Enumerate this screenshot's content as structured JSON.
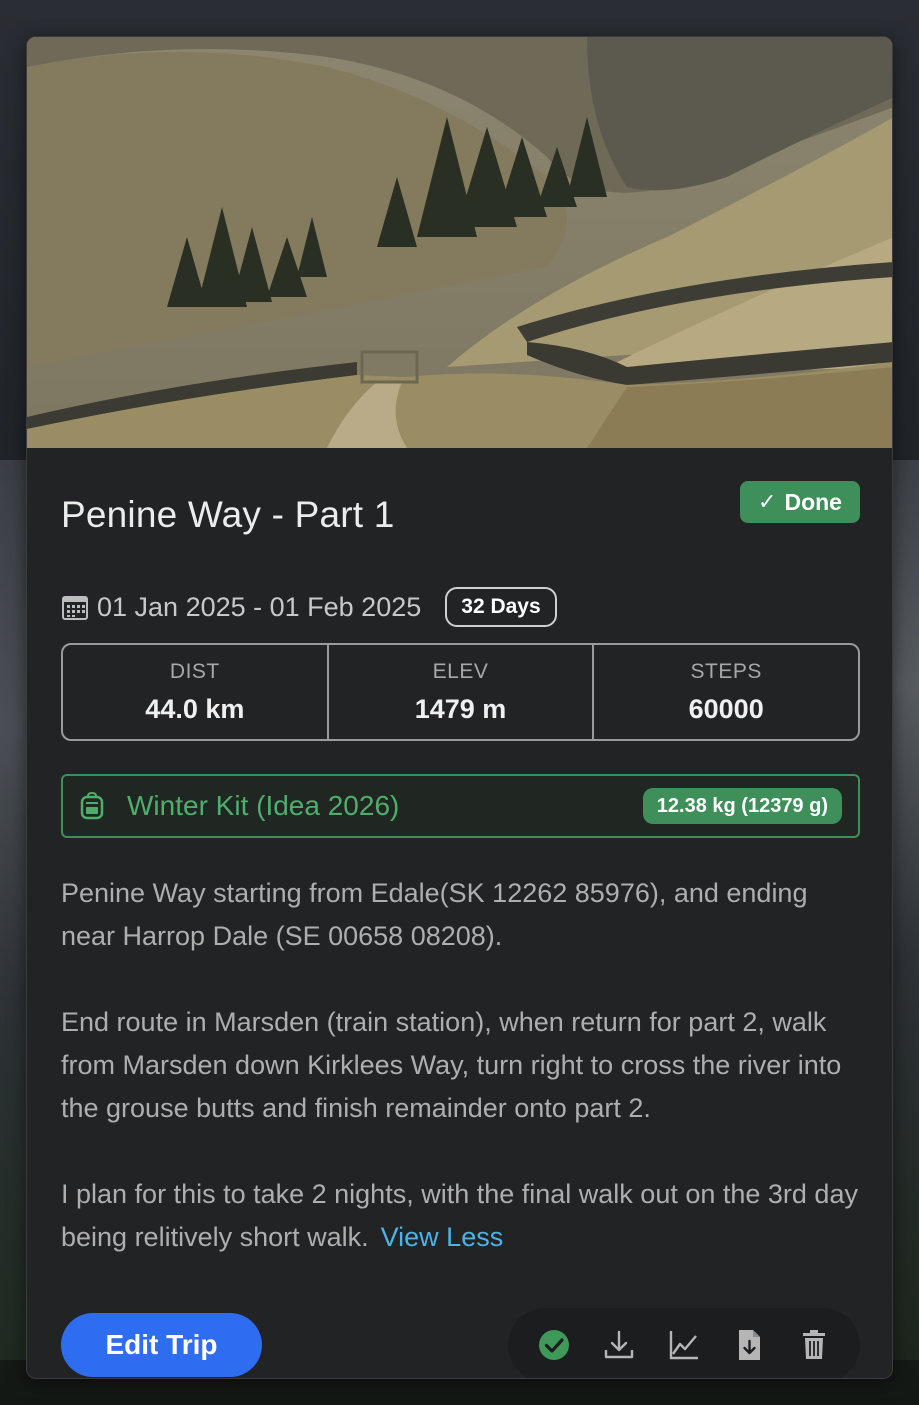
{
  "trip": {
    "title": "Penine Way - Part 1",
    "status": {
      "icon": "checkmark-icon",
      "label": "Done",
      "color": "#3f8f5a"
    },
    "date_range": "01 Jan 2025 - 01 Feb 2025",
    "duration": "32 Days"
  },
  "stats": [
    {
      "label": "DIST",
      "value": "44.0 km"
    },
    {
      "label": "ELEV",
      "value": "1479 m"
    },
    {
      "label": "STEPS",
      "value": "60000"
    }
  ],
  "kit": {
    "icon": "backpack-icon",
    "name": "Winter Kit (Idea 2026)",
    "weight": "12.38 kg (12379 g)",
    "color": "#4fae6c"
  },
  "description": {
    "paragraphs": [
      "Penine Way starting from Edale(SK 12262 85976), and ending near Harrop Dale (SE 00658 08208).",
      "End route in Marsden (train station), when return for part 2, walk from Marsden down Kirklees Way, turn right to cross the river into the grouse butts and finish remainder onto part 2.",
      "I plan for this to take 2 nights, with the final walk out on the 3rd day being relitively short walk."
    ],
    "toggle_label": "View Less",
    "link_color": "#4bb3e6"
  },
  "buttons": {
    "edit": "Edit Trip",
    "edit_color": "#2f6df0"
  },
  "actions": [
    {
      "icon": "check-circle-icon"
    },
    {
      "icon": "download-icon"
    },
    {
      "icon": "chart-icon"
    },
    {
      "icon": "file-download-icon"
    },
    {
      "icon": "trash-icon"
    }
  ]
}
